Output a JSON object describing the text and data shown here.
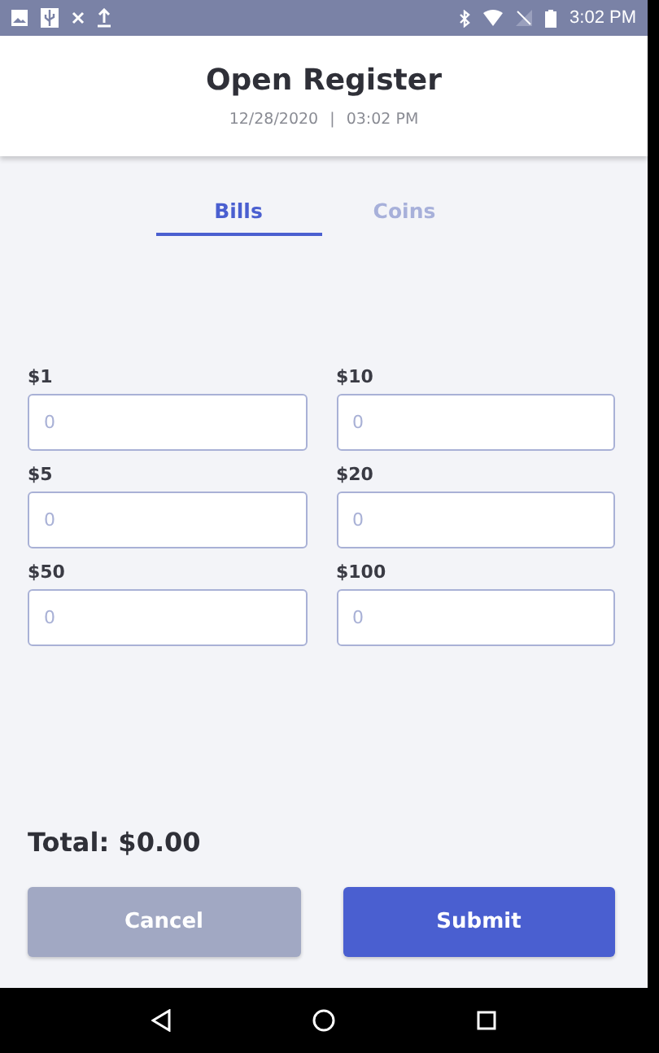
{
  "status_bar": {
    "time": "3:02 PM"
  },
  "header": {
    "title": "Open Register",
    "date": "12/28/2020",
    "separator": "|",
    "time": "03:02 PM"
  },
  "tabs": [
    {
      "label": "Bills",
      "selected": true
    },
    {
      "label": "Coins",
      "selected": false
    }
  ],
  "fields": [
    {
      "label": "$1",
      "placeholder": "0"
    },
    {
      "label": "$10",
      "placeholder": "0"
    },
    {
      "label": "$5",
      "placeholder": "0"
    },
    {
      "label": "$20",
      "placeholder": "0"
    },
    {
      "label": "$50",
      "placeholder": "0"
    },
    {
      "label": "$100",
      "placeholder": "0"
    }
  ],
  "total": "Total: $0.00",
  "buttons": [
    {
      "label": "Cancel",
      "kind": "secondary"
    },
    {
      "label": "Submit",
      "kind": "primary"
    }
  ]
}
